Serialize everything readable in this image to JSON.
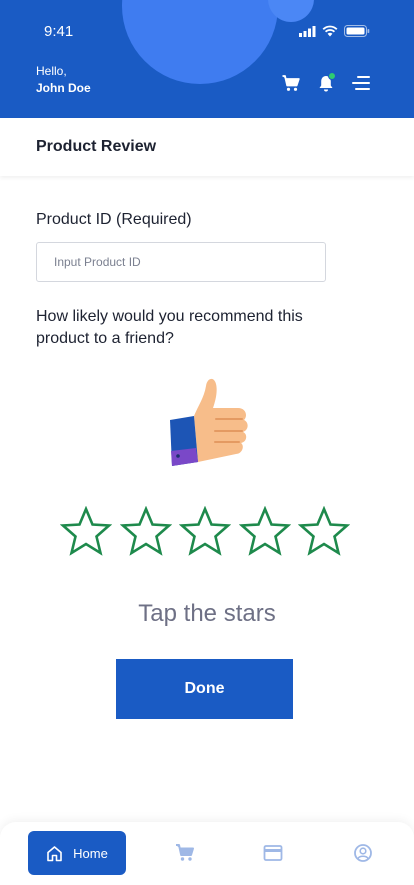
{
  "status_bar": {
    "time": "9:41"
  },
  "header": {
    "greeting": "Hello,",
    "user_name": "John Doe"
  },
  "page": {
    "title": "Product Review"
  },
  "form": {
    "product_id_label": "Product ID (Required)",
    "product_id_placeholder": "Input Product ID",
    "product_id_value": "",
    "question": "How likely would you recommend this product to a friend?"
  },
  "rating": {
    "max_stars": 5,
    "selected": 0,
    "hint": "Tap the stars",
    "star_color": "#1e8a4c"
  },
  "actions": {
    "done_label": "Done"
  },
  "bottom_nav": {
    "items": [
      {
        "icon": "home-icon",
        "label": "Home",
        "active": true
      },
      {
        "icon": "cart-icon",
        "active": false
      },
      {
        "icon": "card-icon",
        "active": false
      },
      {
        "icon": "profile-icon",
        "active": false
      }
    ]
  },
  "colors": {
    "primary": "#1a5bc4",
    "inactive_icon": "#9fb8e6",
    "notification_dot": "#2ecc71"
  }
}
